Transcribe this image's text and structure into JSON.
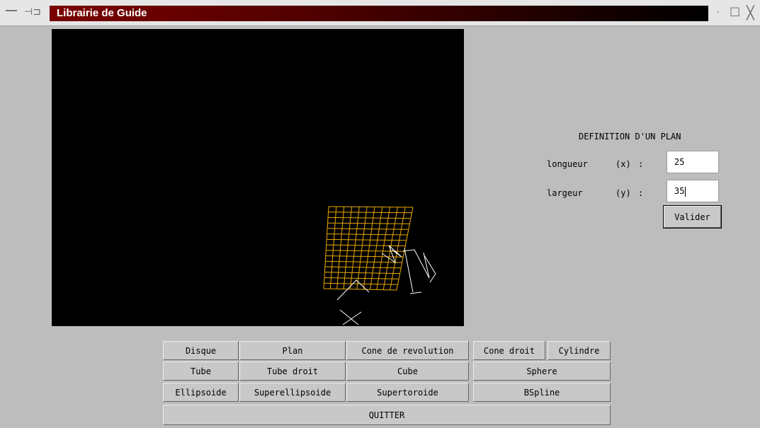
{
  "window": {
    "title": "Librairie de Guide"
  },
  "panel": {
    "title": "DEFINITION D'UN PLAN",
    "length_label": "longueur",
    "length_axis": "(x)",
    "width_label": "largeur",
    "width_axis": "(y)",
    "colon": ":",
    "length_value": "25",
    "width_value": "35",
    "validate_label": "Valider"
  },
  "buttons": {
    "disque": "Disque",
    "plan": "Plan",
    "cone_revolution": "Cone de revolution",
    "cone_droit": "Cone droit",
    "cylindre": "Cylindre",
    "tube": "Tube",
    "tube_droit": "Tube droit",
    "cube": "Cube",
    "sphere": "Sphere",
    "ellipsoide": "Ellipsoide",
    "superellipsoide": "Superellipsoide",
    "supertoroide": "Supertoroide",
    "bspline": "BSpline",
    "quitter": "QUITTER"
  },
  "colors": {
    "mesh": "#e8a800",
    "axes": "#ffffff",
    "canvas": "#000000"
  }
}
